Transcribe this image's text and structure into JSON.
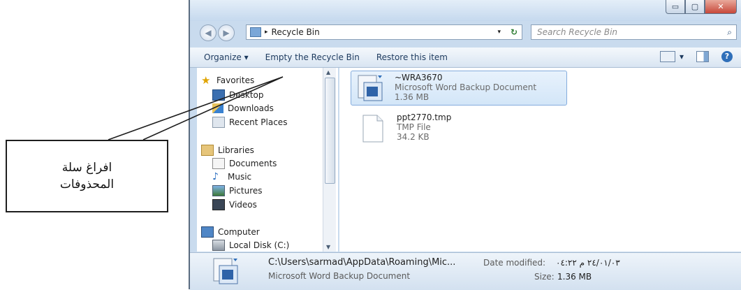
{
  "window": {
    "caption_buttons": {
      "minimize": "▭",
      "maximize": "▢",
      "close": "✕"
    }
  },
  "address": {
    "breadcrumb_sep": "▸",
    "location": "Recycle Bin",
    "dropdown": "▾",
    "refresh": "↻",
    "search_placeholder": "Search Recycle Bin",
    "search_icon": "⌕",
    "back": "◀",
    "forward": "▶"
  },
  "toolbar": {
    "organize_label": "Organize",
    "organize_arrow": "▾",
    "empty_label": "Empty the Recycle Bin",
    "restore_label": "Restore this item",
    "view_arrow": "▾",
    "help": "?"
  },
  "nav": {
    "favorites": "Favorites",
    "desktop": "Desktop",
    "downloads": "Downloads",
    "recent": "Recent Places",
    "libraries": "Libraries",
    "documents": "Documents",
    "music": "Music",
    "pictures": "Pictures",
    "videos": "Videos",
    "computer": "Computer",
    "localdisk": "Local Disk (C:)"
  },
  "files": [
    {
      "name": "~WRA3670",
      "type": "Microsoft Word Backup Document",
      "size": "1.36 MB"
    },
    {
      "name": "ppt2770.tmp",
      "type": "TMP File",
      "size": "34.2 KB"
    }
  ],
  "details": {
    "path": "C:\\Users\\sarmad\\AppData\\Roaming\\Mic...",
    "type": "Microsoft Word Backup Document",
    "date_label": "Date modified:",
    "date_value": "٢٤/٠١/٠٣ م ٠٤:٢٢",
    "size_label": "Size:",
    "size_value": "1.36 MB"
  },
  "callout": {
    "line1": "افراغ سلة",
    "line2": "المحذوفات"
  },
  "colors": {
    "accent": "#2f6fb9",
    "window_frame": "#c9dbee",
    "selection": "#d3e6f8"
  }
}
